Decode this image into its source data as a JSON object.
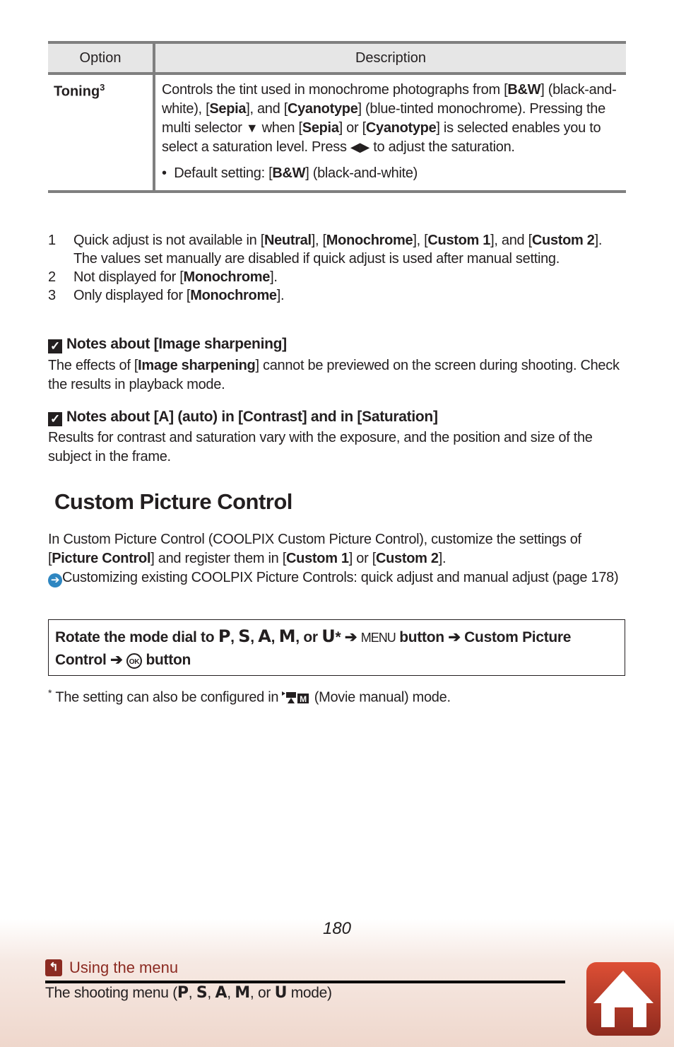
{
  "table": {
    "headers": {
      "option": "Option",
      "description": "Description"
    },
    "rows": [
      {
        "option": "Toning",
        "option_sup": "3",
        "description": {
          "p1": "Controls the tint used in monochrome photographs from [",
          "b1": "B&W",
          "p2": "] (black-and-white), [",
          "b2": "Sepia",
          "p3": "], and [",
          "b3": "Cyanotype",
          "p4": "] (blue-tinted monochrome). Pressing the multi selector ",
          "down_glyph": "▼",
          "p5": " when [",
          "b4": "Sepia",
          "p6": "] or [",
          "b5": "Cyanotype",
          "p7": "] is selected enables you to select a saturation level. Press ",
          "lr_glyph": "◀▶",
          "p8": " to adjust the saturation."
        },
        "default": {
          "pre": "Default setting: [",
          "bold": "B&W",
          "post": "] (black-and-white)"
        }
      }
    ]
  },
  "footnotes": [
    {
      "num": "1",
      "t1": "Quick adjust is not available in [",
      "b1": "Neutral",
      "t2": "], [",
      "b2": "Monochrome",
      "t3": "], [",
      "b3": "Custom 1",
      "t4": "], and [",
      "b4": "Custom 2",
      "t5": "].",
      "extra": "The values set manually are disabled if quick adjust is used after manual setting."
    },
    {
      "num": "2",
      "t1": "Not displayed for [",
      "b1": "Monochrome",
      "t2": "]."
    },
    {
      "num": "3",
      "t1": "Only displayed for [",
      "b1": "Monochrome",
      "t2": "]."
    }
  ],
  "notes": [
    {
      "icon": "✓",
      "title": "Notes about [Image sharpening]",
      "t1": "The effects of [",
      "b1": "Image sharpening",
      "t2": "] cannot be previewed on the screen during shooting. Check the results in playback mode."
    },
    {
      "icon": "✓",
      "title": "Notes about [A] (auto) in [Contrast] and in [Saturation]",
      "t1": "Results for contrast and saturation vary with the exposure, and the position and size of the subject in the frame."
    }
  ],
  "section": {
    "title": "Custom Picture Control",
    "intro": {
      "t1": "In Custom Picture Control (COOLPIX Custom Picture Control), customize the settings of [",
      "b1": "Picture Control",
      "t2": "] and register them in [",
      "b2": "Custom 1",
      "t3": "] or [",
      "b3": "Custom 2",
      "t4": "]."
    },
    "link": {
      "arrow": "➔",
      "text": "Customizing existing COOLPIX Picture Controls: quick adjust and manual adjust (page 178)"
    }
  },
  "procedure": {
    "t1": "Rotate the mode dial to ",
    "modes": [
      "P",
      "S",
      "A",
      "M"
    ],
    "or": "or",
    "last_mode": "U",
    "asterisk": "*",
    "arrow": "➔",
    "menu_glyph": "MENU",
    "t2": "button",
    "t3": "Custom Picture Control",
    "ok_glyph": "OK",
    "t4": "button"
  },
  "star_note": {
    "mark": "*",
    "t1": "The setting can also be configured in",
    "t2": "(Movie manual) mode."
  },
  "page_number": "180",
  "footer": {
    "back_icon": "↰",
    "back_label": "Using the menu",
    "sub": {
      "t1": "The shooting menu (",
      "modes": [
        "P",
        "S",
        "A",
        "M"
      ],
      "or": "or",
      "last": "U",
      "t2": "mode)"
    },
    "colors": {
      "accent": "#8c2b22",
      "home_top": "#de4f35",
      "home_bottom": "#8e2a1e"
    }
  }
}
